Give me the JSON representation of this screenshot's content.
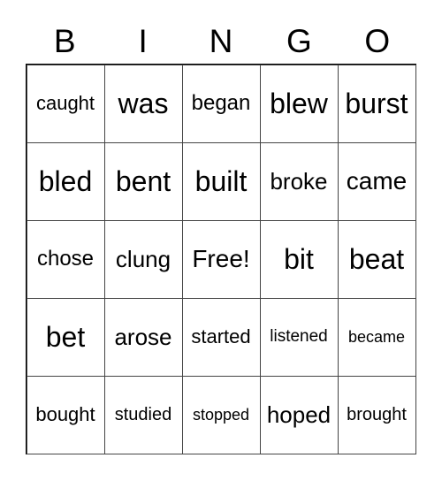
{
  "header": [
    "B",
    "I",
    "N",
    "G",
    "O"
  ],
  "cells": [
    "caught",
    "was",
    "began",
    "blew",
    "burst",
    "bled",
    "bent",
    "built",
    "broke",
    "came",
    "chose",
    "clung",
    "Free!",
    "bit",
    "beat",
    "bet",
    "arose",
    "started",
    "listened",
    "became",
    "bought",
    "studied",
    "stopped",
    "hoped",
    "brought"
  ]
}
